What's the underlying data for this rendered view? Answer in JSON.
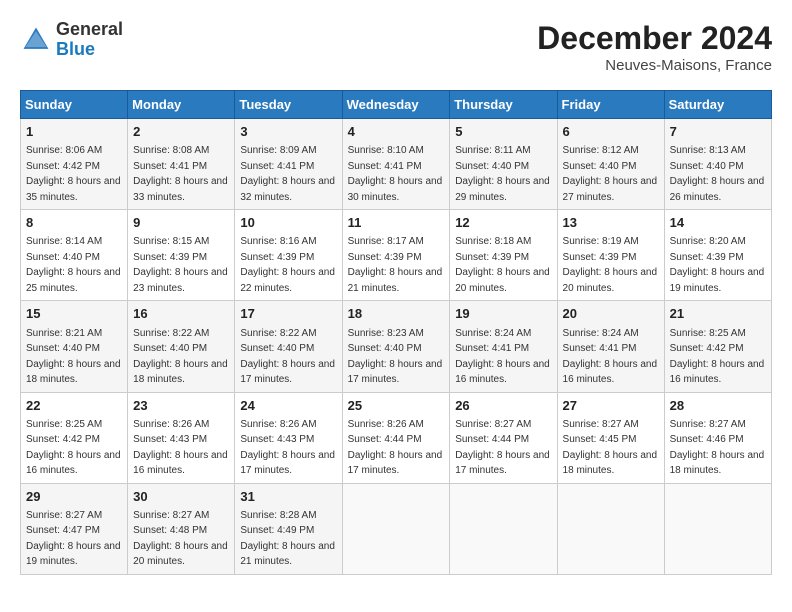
{
  "logo": {
    "line1": "General",
    "line2": "Blue"
  },
  "title": "December 2024",
  "location": "Neuves-Maisons, France",
  "days_header": [
    "Sunday",
    "Monday",
    "Tuesday",
    "Wednesday",
    "Thursday",
    "Friday",
    "Saturday"
  ],
  "weeks": [
    [
      {
        "day": "1",
        "sunrise": "8:06 AM",
        "sunset": "4:42 PM",
        "daylight": "8 hours and 35 minutes."
      },
      {
        "day": "2",
        "sunrise": "8:08 AM",
        "sunset": "4:41 PM",
        "daylight": "8 hours and 33 minutes."
      },
      {
        "day": "3",
        "sunrise": "8:09 AM",
        "sunset": "4:41 PM",
        "daylight": "8 hours and 32 minutes."
      },
      {
        "day": "4",
        "sunrise": "8:10 AM",
        "sunset": "4:41 PM",
        "daylight": "8 hours and 30 minutes."
      },
      {
        "day": "5",
        "sunrise": "8:11 AM",
        "sunset": "4:40 PM",
        "daylight": "8 hours and 29 minutes."
      },
      {
        "day": "6",
        "sunrise": "8:12 AM",
        "sunset": "4:40 PM",
        "daylight": "8 hours and 27 minutes."
      },
      {
        "day": "7",
        "sunrise": "8:13 AM",
        "sunset": "4:40 PM",
        "daylight": "8 hours and 26 minutes."
      }
    ],
    [
      {
        "day": "8",
        "sunrise": "8:14 AM",
        "sunset": "4:40 PM",
        "daylight": "8 hours and 25 minutes."
      },
      {
        "day": "9",
        "sunrise": "8:15 AM",
        "sunset": "4:39 PM",
        "daylight": "8 hours and 23 minutes."
      },
      {
        "day": "10",
        "sunrise": "8:16 AM",
        "sunset": "4:39 PM",
        "daylight": "8 hours and 22 minutes."
      },
      {
        "day": "11",
        "sunrise": "8:17 AM",
        "sunset": "4:39 PM",
        "daylight": "8 hours and 21 minutes."
      },
      {
        "day": "12",
        "sunrise": "8:18 AM",
        "sunset": "4:39 PM",
        "daylight": "8 hours and 20 minutes."
      },
      {
        "day": "13",
        "sunrise": "8:19 AM",
        "sunset": "4:39 PM",
        "daylight": "8 hours and 20 minutes."
      },
      {
        "day": "14",
        "sunrise": "8:20 AM",
        "sunset": "4:39 PM",
        "daylight": "8 hours and 19 minutes."
      }
    ],
    [
      {
        "day": "15",
        "sunrise": "8:21 AM",
        "sunset": "4:40 PM",
        "daylight": "8 hours and 18 minutes."
      },
      {
        "day": "16",
        "sunrise": "8:22 AM",
        "sunset": "4:40 PM",
        "daylight": "8 hours and 18 minutes."
      },
      {
        "day": "17",
        "sunrise": "8:22 AM",
        "sunset": "4:40 PM",
        "daylight": "8 hours and 17 minutes."
      },
      {
        "day": "18",
        "sunrise": "8:23 AM",
        "sunset": "4:40 PM",
        "daylight": "8 hours and 17 minutes."
      },
      {
        "day": "19",
        "sunrise": "8:24 AM",
        "sunset": "4:41 PM",
        "daylight": "8 hours and 16 minutes."
      },
      {
        "day": "20",
        "sunrise": "8:24 AM",
        "sunset": "4:41 PM",
        "daylight": "8 hours and 16 minutes."
      },
      {
        "day": "21",
        "sunrise": "8:25 AM",
        "sunset": "4:42 PM",
        "daylight": "8 hours and 16 minutes."
      }
    ],
    [
      {
        "day": "22",
        "sunrise": "8:25 AM",
        "sunset": "4:42 PM",
        "daylight": "8 hours and 16 minutes."
      },
      {
        "day": "23",
        "sunrise": "8:26 AM",
        "sunset": "4:43 PM",
        "daylight": "8 hours and 16 minutes."
      },
      {
        "day": "24",
        "sunrise": "8:26 AM",
        "sunset": "4:43 PM",
        "daylight": "8 hours and 17 minutes."
      },
      {
        "day": "25",
        "sunrise": "8:26 AM",
        "sunset": "4:44 PM",
        "daylight": "8 hours and 17 minutes."
      },
      {
        "day": "26",
        "sunrise": "8:27 AM",
        "sunset": "4:44 PM",
        "daylight": "8 hours and 17 minutes."
      },
      {
        "day": "27",
        "sunrise": "8:27 AM",
        "sunset": "4:45 PM",
        "daylight": "8 hours and 18 minutes."
      },
      {
        "day": "28",
        "sunrise": "8:27 AM",
        "sunset": "4:46 PM",
        "daylight": "8 hours and 18 minutes."
      }
    ],
    [
      {
        "day": "29",
        "sunrise": "8:27 AM",
        "sunset": "4:47 PM",
        "daylight": "8 hours and 19 minutes."
      },
      {
        "day": "30",
        "sunrise": "8:27 AM",
        "sunset": "4:48 PM",
        "daylight": "8 hours and 20 minutes."
      },
      {
        "day": "31",
        "sunrise": "8:28 AM",
        "sunset": "4:49 PM",
        "daylight": "8 hours and 21 minutes."
      },
      null,
      null,
      null,
      null
    ]
  ]
}
